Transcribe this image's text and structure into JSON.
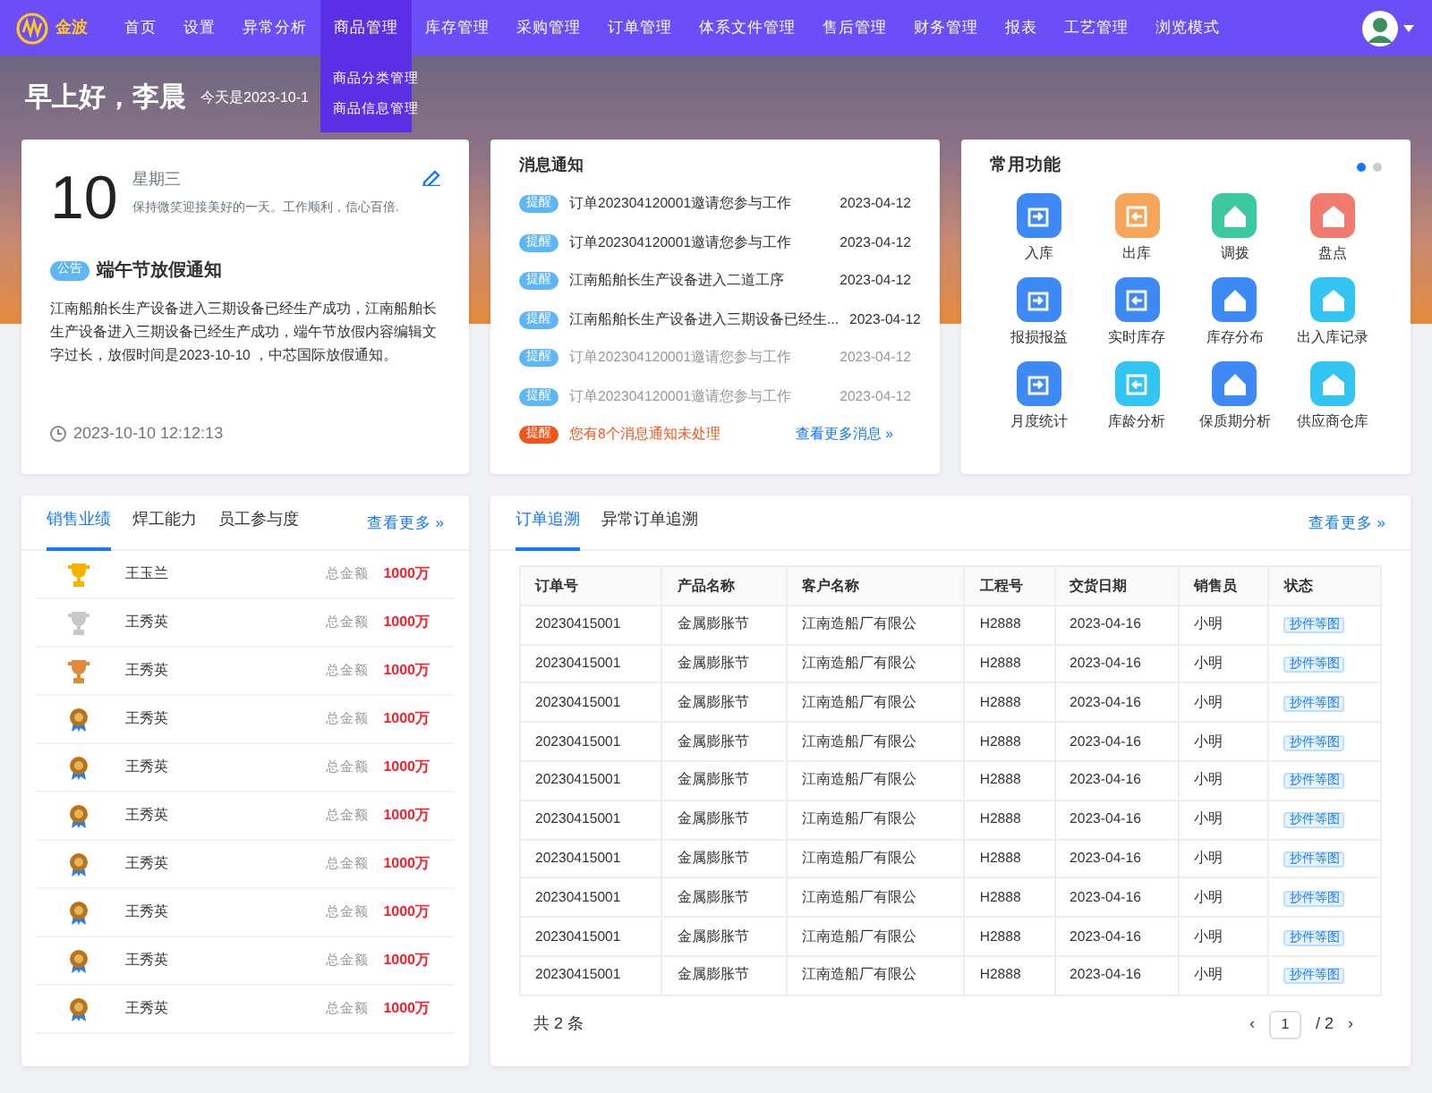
{
  "nav": {
    "logo": "金波",
    "items": [
      {
        "label": "首页",
        "selected": false
      },
      {
        "label": "设置",
        "selected": false
      },
      {
        "label": "异常分析",
        "selected": false
      },
      {
        "label": "商品管理",
        "selected": true,
        "expanded": true,
        "menu": [
          "商品分类管理",
          "商品信息管理"
        ]
      },
      {
        "label": "库存管理",
        "selected": false
      },
      {
        "label": "采购管理",
        "selected": false
      },
      {
        "label": "订单管理",
        "selected": false
      },
      {
        "label": "体系文件管理",
        "selected": false
      },
      {
        "label": "售后管理",
        "selected": false
      },
      {
        "label": "财务管理",
        "selected": false
      },
      {
        "label": "报表",
        "selected": false
      },
      {
        "label": "工艺管理",
        "selected": false
      },
      {
        "label": "浏览模式",
        "selected": false
      }
    ]
  },
  "greeting": {
    "title": "早上好，李晨",
    "date": "今天是2023-10-1"
  },
  "calendar": {
    "day": "10",
    "weekday": "星期三",
    "motto": "保持微笑迎接美好的一天。工作顺利，信心百倍.",
    "tag": "公告",
    "notice_title": "端午节放假通知",
    "notice_body": "江南船舶长生产设备进入三期设备已经生产成功，江南船舶长生产设备进入三期设备已经生产成功，端午节放假内容编辑文字过长，放假时间是2023-10-10 ，中芯国际放假通知。",
    "time": "2023-10-10 12:12:13"
  },
  "messages": {
    "title": "消息通知",
    "items": [
      {
        "tag": "提醒",
        "text": "订单202304120001邀请您参与工作",
        "date": "2023-04-12",
        "read": false
      },
      {
        "tag": "提醒",
        "text": "订单202304120001邀请您参与工作",
        "date": "2023-04-12",
        "read": false
      },
      {
        "tag": "提醒",
        "text": "江南船舶长生产设备进入二道工序",
        "date": "2023-04-12",
        "read": false
      },
      {
        "tag": "提醒",
        "text": "江南船舶长生产设备进入三期设备已经生...",
        "date": "2023-04-12",
        "read": false
      },
      {
        "tag": "提醒",
        "text": "订单202304120001邀请您参与工作",
        "date": "2023-04-12",
        "read": true
      },
      {
        "tag": "提醒",
        "text": "订单202304120001邀请您参与工作",
        "date": "2023-04-12",
        "read": true
      }
    ],
    "alert": {
      "tag": "提醒",
      "text": "您有8个消息通知未处理"
    },
    "more": "查看更多消息 »"
  },
  "functions": {
    "title": "常用功能",
    "pages": [
      {
        "selected": true
      },
      {
        "selected": false
      }
    ],
    "items": [
      {
        "label": "入库",
        "color": "#3d8af7"
      },
      {
        "label": "出库",
        "color": "#f5a65b"
      },
      {
        "label": "调拨",
        "color": "#3cc8a0"
      },
      {
        "label": "盘点",
        "color": "#f07b6e"
      },
      {
        "label": "报损报益",
        "color": "#3d8af7"
      },
      {
        "label": "实时库存",
        "color": "#3d8af7"
      },
      {
        "label": "库存分布",
        "color": "#3d8af7"
      },
      {
        "label": "出入库记录",
        "color": "#32c5f4"
      },
      {
        "label": "月度统计",
        "color": "#3d8af7"
      },
      {
        "label": "库龄分析",
        "color": "#32c5f4"
      },
      {
        "label": "保质期分析",
        "color": "#3d8af7"
      },
      {
        "label": "供应商仓库",
        "color": "#32c5f4"
      }
    ]
  },
  "ranking": {
    "tabs": [
      {
        "label": "销售业绩",
        "selected": true
      },
      {
        "label": "焊工能力",
        "selected": false
      },
      {
        "label": "员工参与度",
        "selected": false
      }
    ],
    "more": "查看更多 »",
    "rows": [
      {
        "kind": "gold",
        "name": "王玉兰",
        "label": "总金额",
        "amount": "1000万"
      },
      {
        "kind": "silver",
        "name": "王秀英",
        "label": "总金额",
        "amount": "1000万"
      },
      {
        "kind": "bronze",
        "name": "王秀英",
        "label": "总金额",
        "amount": "1000万"
      },
      {
        "kind": "medal",
        "name": "王秀英",
        "label": "总金额",
        "amount": "1000万"
      },
      {
        "kind": "medal",
        "name": "王秀英",
        "label": "总金额",
        "amount": "1000万"
      },
      {
        "kind": "medal",
        "name": "王秀英",
        "label": "总金额",
        "amount": "1000万"
      },
      {
        "kind": "medal",
        "name": "王秀英",
        "label": "总金额",
        "amount": "1000万"
      },
      {
        "kind": "medal",
        "name": "王秀英",
        "label": "总金额",
        "amount": "1000万"
      },
      {
        "kind": "medal",
        "name": "王秀英",
        "label": "总金额",
        "amount": "1000万"
      },
      {
        "kind": "medal",
        "name": "王秀英",
        "label": "总金额",
        "amount": "1000万"
      }
    ]
  },
  "orders": {
    "tabs": [
      {
        "label": "订单追溯",
        "selected": true
      },
      {
        "label": "异常订单追溯",
        "selected": false
      }
    ],
    "more": "查看更多 »",
    "columns": [
      "订单号",
      "产品名称",
      "客户名称",
      "工程号",
      "交货日期",
      "销售员",
      "状态"
    ],
    "rows": [
      [
        "20230415001",
        "金属膨胀节",
        "江南造船厂有限公",
        "H2888",
        "2023-04-16",
        "小明",
        "抄件等图"
      ],
      [
        "20230415001",
        "金属膨胀节",
        "江南造船厂有限公",
        "H2888",
        "2023-04-16",
        "小明",
        "抄件等图"
      ],
      [
        "20230415001",
        "金属膨胀节",
        "江南造船厂有限公",
        "H2888",
        "2023-04-16",
        "小明",
        "抄件等图"
      ],
      [
        "20230415001",
        "金属膨胀节",
        "江南造船厂有限公",
        "H2888",
        "2023-04-16",
        "小明",
        "抄件等图"
      ],
      [
        "20230415001",
        "金属膨胀节",
        "江南造船厂有限公",
        "H2888",
        "2023-04-16",
        "小明",
        "抄件等图"
      ],
      [
        "20230415001",
        "金属膨胀节",
        "江南造船厂有限公",
        "H2888",
        "2023-04-16",
        "小明",
        "抄件等图"
      ],
      [
        "20230415001",
        "金属膨胀节",
        "江南造船厂有限公",
        "H2888",
        "2023-04-16",
        "小明",
        "抄件等图"
      ],
      [
        "20230415001",
        "金属膨胀节",
        "江南造船厂有限公",
        "H2888",
        "2023-04-16",
        "小明",
        "抄件等图"
      ],
      [
        "20230415001",
        "金属膨胀节",
        "江南造船厂有限公",
        "H2888",
        "2023-04-16",
        "小明",
        "抄件等图"
      ],
      [
        "20230415001",
        "金属膨胀节",
        "江南造船厂有限公",
        "H2888",
        "2023-04-16",
        "小明",
        "抄件等图"
      ]
    ],
    "total": "共 2 条",
    "pager": {
      "prev": "‹",
      "page": "1",
      "of": "/ 2",
      "next": "›"
    }
  }
}
